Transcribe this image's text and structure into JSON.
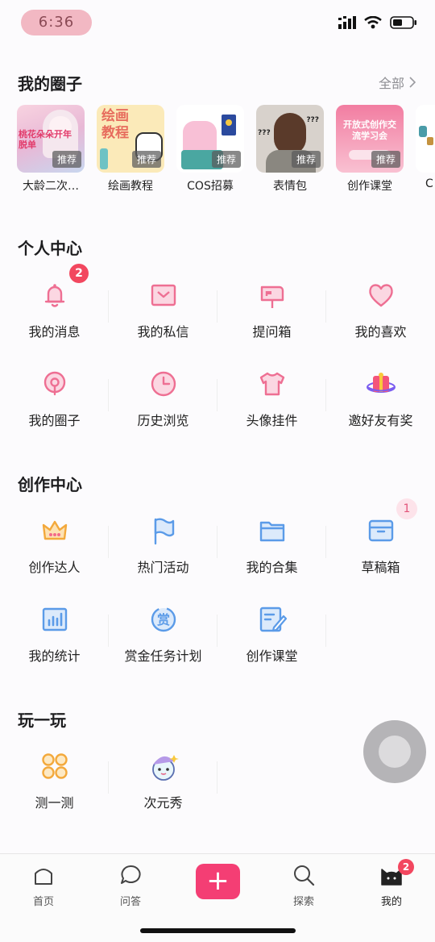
{
  "status_bar": {
    "time": "6:36"
  },
  "circles_section": {
    "title": "我的圈子",
    "see_all": "全部",
    "items": [
      {
        "name": "大龄二次…",
        "tag": "推荐",
        "art_text": "桃花朵朵开年脱单"
      },
      {
        "name": "绘画教程",
        "tag": "推荐",
        "art_text": "绘画教程"
      },
      {
        "name": "COS招募",
        "tag": "推荐"
      },
      {
        "name": "表情包",
        "tag": "推荐",
        "art_text": "???"
      },
      {
        "name": "创作课堂",
        "tag": "推荐",
        "art_text": "开放式创作交流学习会"
      },
      {
        "name": "C"
      }
    ]
  },
  "personal_center": {
    "title": "个人中心",
    "items": [
      {
        "label": "我的消息",
        "icon": "bell-icon",
        "badge": "2"
      },
      {
        "label": "我的私信",
        "icon": "mail-icon"
      },
      {
        "label": "提问箱",
        "icon": "mailbox-icon"
      },
      {
        "label": "我的喜欢",
        "icon": "heart-icon"
      },
      {
        "label": "我的圈子",
        "icon": "location-pin-icon"
      },
      {
        "label": "历史浏览",
        "icon": "clock-icon"
      },
      {
        "label": "头像挂件",
        "icon": "tshirt-icon"
      },
      {
        "label": "邀好友有奖",
        "icon": "gift-planet-icon"
      }
    ]
  },
  "creation_center": {
    "title": "创作中心",
    "items": [
      {
        "label": "创作达人",
        "icon": "crown-icon"
      },
      {
        "label": "热门活动",
        "icon": "flag-icon"
      },
      {
        "label": "我的合集",
        "icon": "folder-icon"
      },
      {
        "label": "草稿箱",
        "icon": "archive-box-icon",
        "badge": "1"
      },
      {
        "label": "我的统计",
        "icon": "bar-chart-icon"
      },
      {
        "label": "赏金任务计划",
        "icon": "reward-icon",
        "icon_text": "赏"
      },
      {
        "label": "创作课堂",
        "icon": "edit-note-icon"
      }
    ]
  },
  "play_section": {
    "title": "玩一玩",
    "items": [
      {
        "label": "测一测",
        "icon": "four-circles-icon"
      },
      {
        "label": "次元秀",
        "icon": "mascot-icon"
      }
    ]
  },
  "tab_bar": {
    "tabs": [
      {
        "label": "首页",
        "icon": "home-icon"
      },
      {
        "label": "问答",
        "icon": "chat-bubble-icon"
      },
      {
        "label": "+",
        "icon": "plus-icon"
      },
      {
        "label": "探索",
        "icon": "search-icon"
      },
      {
        "label": "我的",
        "icon": "cat-avatar-icon",
        "badge": "2"
      }
    ]
  },
  "colors": {
    "accent": "#f43e74",
    "icon_pink": "#ee6f93",
    "icon_blue": "#5b9be8",
    "icon_gold": "#f3a93c",
    "badge_red": "#f2475f"
  }
}
